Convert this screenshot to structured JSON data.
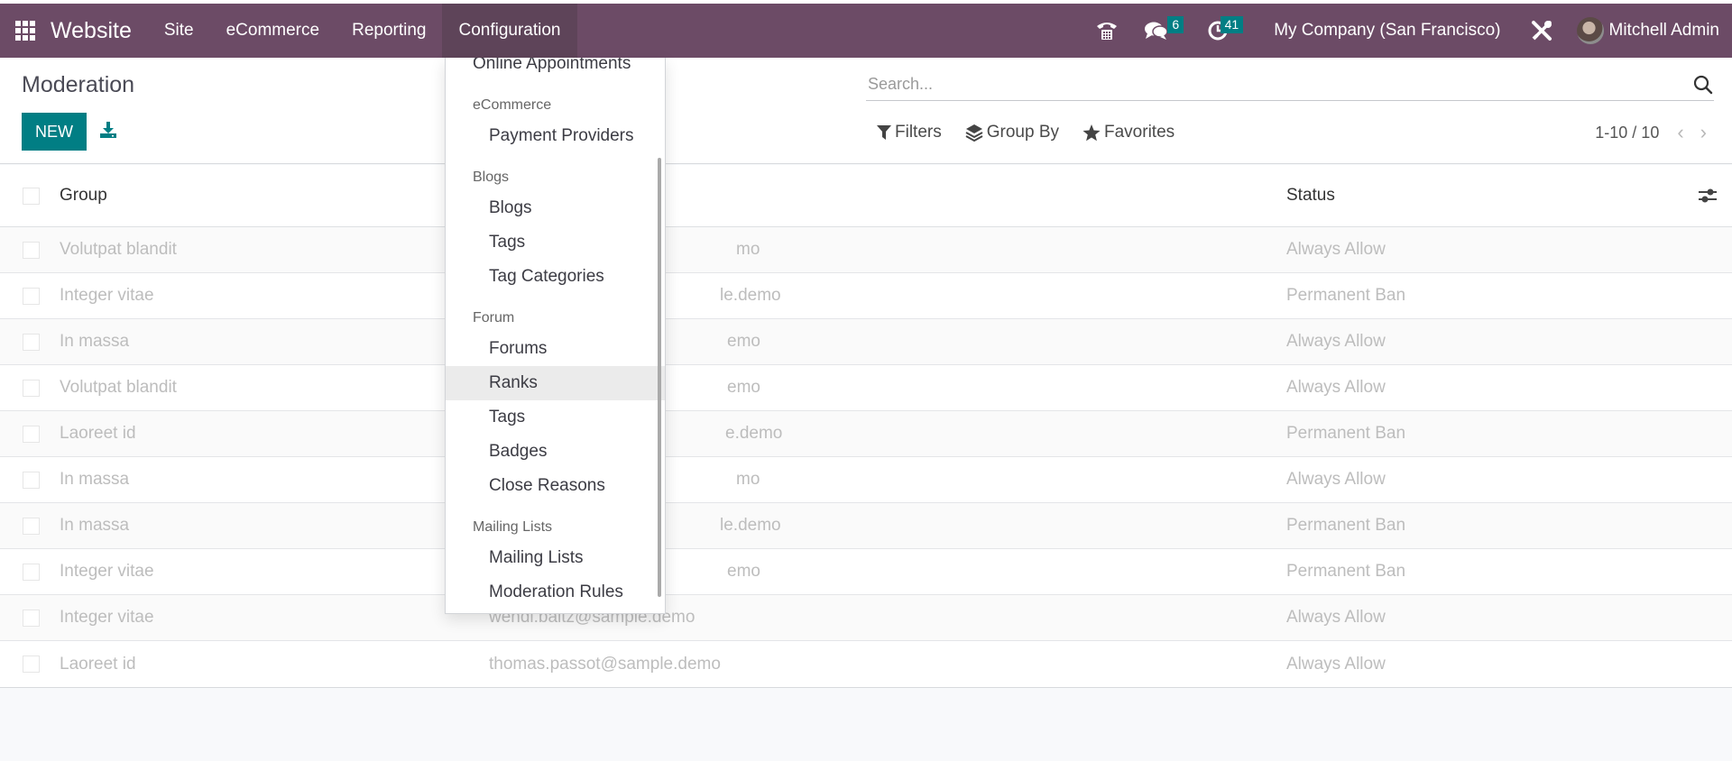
{
  "navbar": {
    "app_name": "Website",
    "menu": [
      {
        "label": "Site"
      },
      {
        "label": "eCommerce"
      },
      {
        "label": "Reporting"
      },
      {
        "label": "Configuration",
        "active": true
      }
    ],
    "icons": {
      "apps": "apps-grid-icon",
      "phone": "phone-icon",
      "chat": "chat-icon",
      "activity": "clock-icon",
      "debug": "tools-icon"
    },
    "chat_badge": "6",
    "activity_badge": "41",
    "company": "My Company (San Francisco)",
    "user": "Mitchell Admin",
    "color": "#6c4b66"
  },
  "control_panel": {
    "title": "Moderation",
    "new_label": "NEW",
    "search_placeholder": "Search...",
    "filters_label": "Filters",
    "group_by_label": "Group By",
    "favorites_label": "Favorites",
    "pager": "1-10 / 10",
    "accent": "#017e84"
  },
  "list": {
    "columns": {
      "group": "Group",
      "email": "",
      "status": "Status"
    },
    "rows": [
      {
        "group": "Volutpat blandit",
        "email": "mo",
        "status": "Always Allow"
      },
      {
        "group": "Integer vitae",
        "email": "le.demo",
        "status": "Permanent Ban"
      },
      {
        "group": "In massa",
        "email": "emo",
        "status": "Always Allow"
      },
      {
        "group": "Volutpat blandit",
        "email": "emo",
        "status": "Always Allow"
      },
      {
        "group": "Laoreet id",
        "email": "e.demo",
        "status": "Permanent Ban"
      },
      {
        "group": "In massa",
        "email": "mo",
        "status": "Always Allow"
      },
      {
        "group": "In massa",
        "email": "le.demo",
        "status": "Permanent Ban"
      },
      {
        "group": "Integer vitae",
        "email": "emo",
        "status": "Permanent Ban"
      },
      {
        "group": "Integer vitae",
        "email": "wendi.baltz@sample.demo",
        "status": "Always Allow"
      },
      {
        "group": "Laoreet id",
        "email": "thomas.passot@sample.demo",
        "status": "Always Allow"
      }
    ]
  },
  "dropdown": {
    "top_item": "Online Appointments",
    "sections": [
      {
        "header": "eCommerce",
        "items": [
          "Payment Providers"
        ]
      },
      {
        "header": "Blogs",
        "items": [
          "Blogs",
          "Tags",
          "Tag Categories"
        ]
      },
      {
        "header": "Forum",
        "items": [
          "Forums",
          "Ranks",
          "Tags",
          "Badges",
          "Close Reasons"
        ]
      },
      {
        "header": "Mailing Lists",
        "items": [
          "Mailing Lists",
          "Moderation Rules"
        ]
      }
    ],
    "hovered_item": "Ranks"
  }
}
